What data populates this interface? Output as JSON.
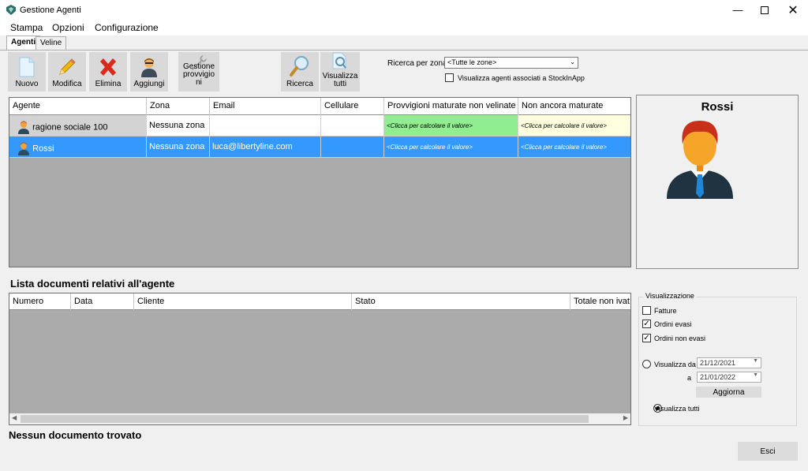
{
  "window": {
    "title": "Gestione Agenti"
  },
  "menu": [
    "Stampa",
    "Opzioni",
    "Configurazione"
  ],
  "tabs": [
    {
      "label": "Agenti"
    },
    {
      "label": "Veline"
    }
  ],
  "toolbar": {
    "nuovo": "Nuovo",
    "modifica": "Modifica",
    "elimina": "Elimina",
    "aggiungi": "Aggiungi",
    "gestione": [
      "Gestione",
      "provvigio",
      "ni"
    ],
    "ricerca": "Ricerca",
    "visualizza": [
      "Visualizza",
      "tutti"
    ]
  },
  "search": {
    "label": "Ricerca per zona",
    "zone_value": "<Tutte le zone>",
    "stockinapp_label": "Visualizza agenti associati a StockInApp"
  },
  "agents_table": {
    "columns": [
      "Agente",
      "Zona",
      "Email",
      "Cellulare",
      "Provvigioni maturate non velinate",
      "Non ancora maturate"
    ],
    "rows": [
      {
        "agente": "ragione sociale 100",
        "zona": "Nessuna zona",
        "email": "",
        "cellulare": "",
        "provvigioni": "<Clicca per calcolare il valore>",
        "non_maturate": "<Clicca per calcolare il valore>"
      },
      {
        "agente": "Rossi",
        "zona": "Nessuna zona",
        "email": "luca@libertyline.com",
        "cellulare": "",
        "provvigioni": "<Clicca per calcolare il valore>",
        "non_maturate": "<Clicca per calcolare il valore>"
      }
    ]
  },
  "selected_agent": {
    "name": "Rossi"
  },
  "documents": {
    "title": "Lista documenti relativi all'agente",
    "columns": [
      "Numero",
      "Data",
      "Cliente",
      "Stato",
      "Totale non ivat"
    ],
    "status": "Nessun documento trovato"
  },
  "view_options": {
    "title": "Visualizzazione",
    "fatture": "Fatture",
    "ordini_evasi": "Ordini evasi",
    "ordini_non_evasi": "Ordini non evasi",
    "visualizza_da": "Visualizza da",
    "date_from": "21/12/2021",
    "a_label": "a",
    "date_to": "21/01/2022",
    "aggiorna": "Aggiorna",
    "visualizza_tutti": "Visualizza tutti"
  },
  "footer": {
    "esci": "Esci"
  },
  "colors": {
    "selection": "#3399ff",
    "green_cell": "#90ee90",
    "yellow_cell": "#ffffe0",
    "grid_bg": "#ababab"
  }
}
